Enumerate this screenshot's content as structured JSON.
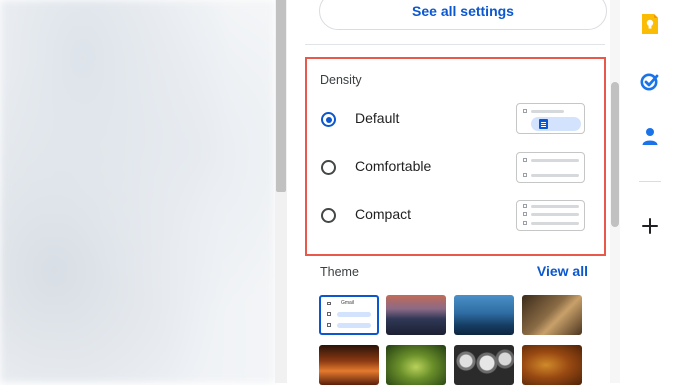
{
  "settings_panel": {
    "see_all_settings": "See all settings",
    "density": {
      "title": "Density",
      "options": [
        {
          "label": "Default",
          "checked": true
        },
        {
          "label": "Comfortable",
          "checked": false
        },
        {
          "label": "Compact",
          "checked": false
        }
      ]
    },
    "theme": {
      "title": "Theme",
      "view_all": "View all",
      "default_mini_logo": "Gmail",
      "thumbnails": [
        "default",
        "beach-sunset",
        "blue-sea",
        "chess",
        "canyon",
        "leaf",
        "pipes",
        "autumn-leaves"
      ]
    }
  },
  "side_rail": {
    "icons": [
      "keep-icon",
      "tasks-icon",
      "contacts-icon",
      "add-icon"
    ]
  },
  "colors": {
    "accent": "#0b57d0",
    "highlight_border": "#e8584b",
    "keep": "#fbbc04"
  }
}
